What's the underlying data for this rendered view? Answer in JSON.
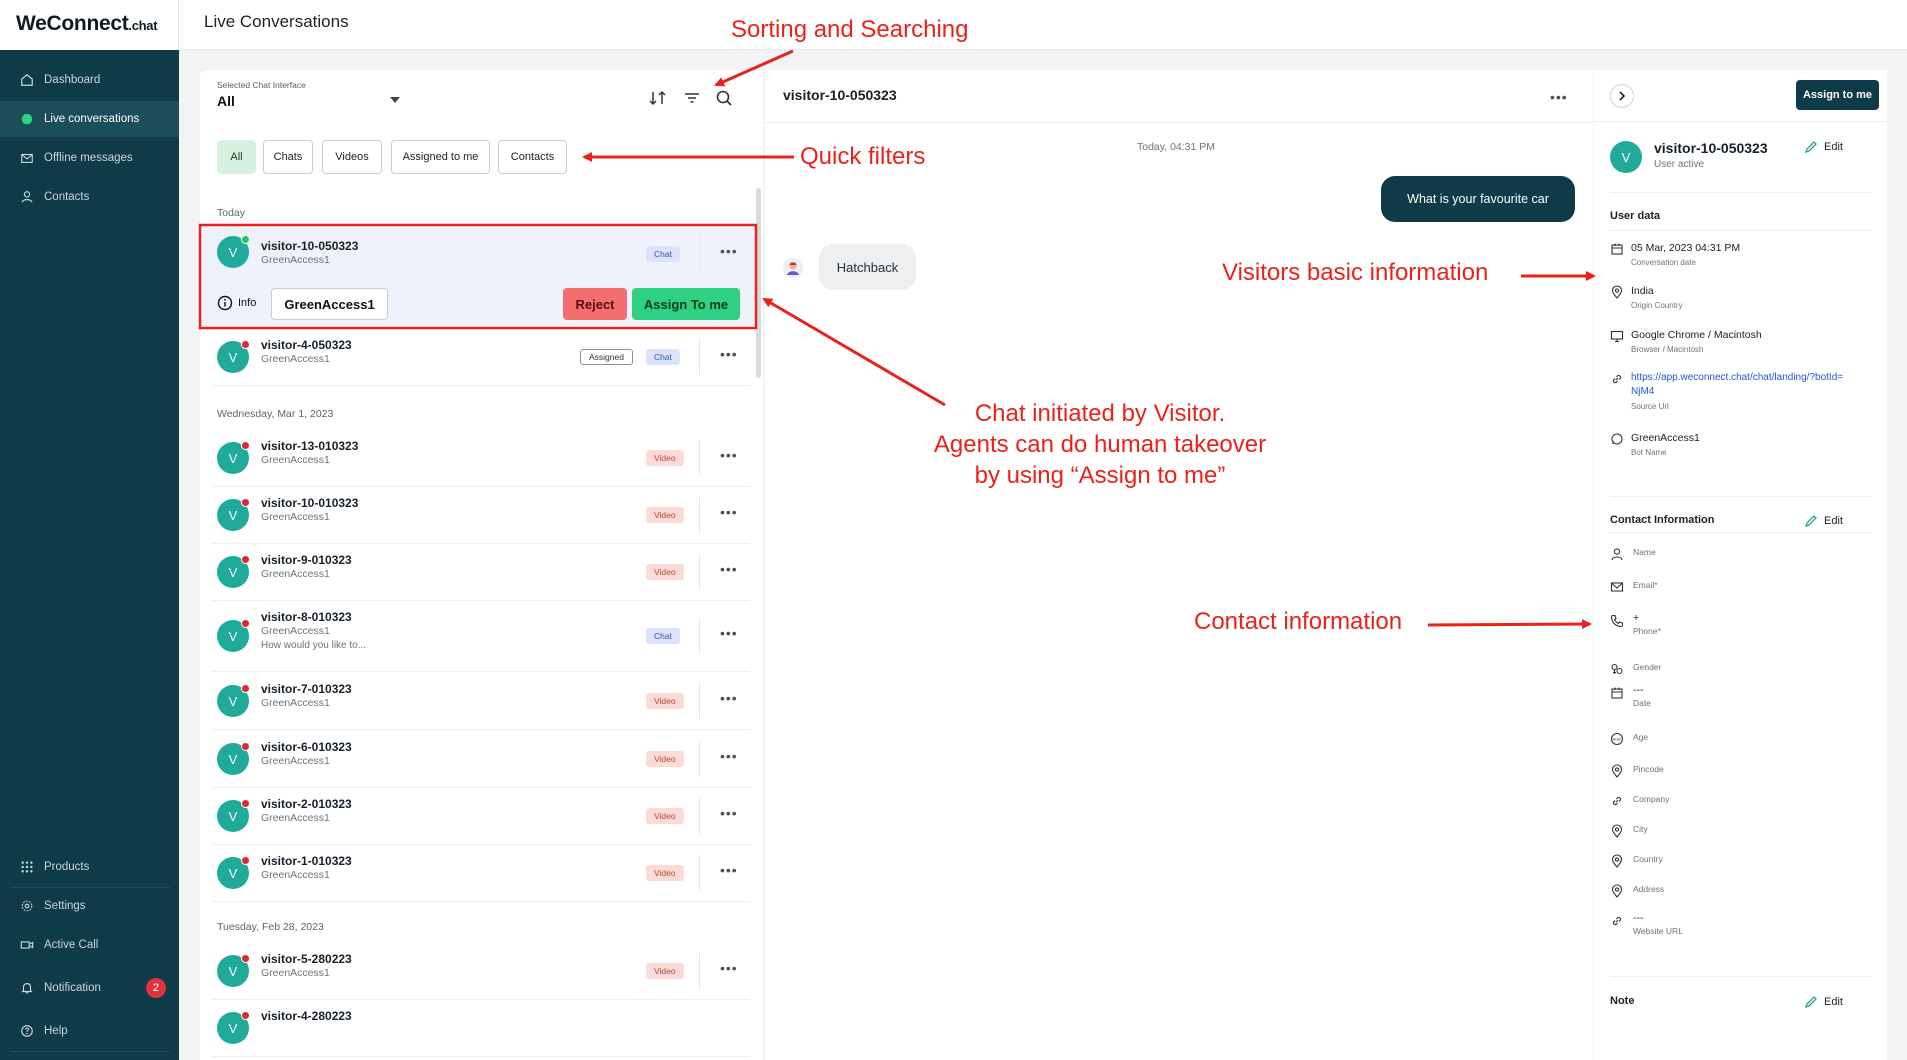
{
  "sidebar": {
    "logo": {
      "brand": "WeConnect",
      "suffix": ".chat"
    },
    "items": [
      {
        "label": "Dashboard",
        "icon": "home-icon"
      },
      {
        "label": "Live conversations",
        "icon": "chat-bubble-icon"
      },
      {
        "label": "Offline messages",
        "icon": "mail-icon"
      },
      {
        "label": "Contacts",
        "icon": "user-icon"
      }
    ],
    "bottom_items": [
      {
        "label": "Products",
        "icon": "grid-icon"
      },
      {
        "label": "Settings",
        "icon": "gear-icon"
      },
      {
        "label": "Active Call",
        "icon": "video-icon"
      },
      {
        "label": "Notification",
        "icon": "bell-icon",
        "badge": "2"
      },
      {
        "label": "Help",
        "icon": "help-icon"
      }
    ]
  },
  "header": {
    "title": "Live Conversations"
  },
  "list": {
    "interface_label": "Selected Chat Interface",
    "interface_value": "All",
    "quick_filters": [
      "All",
      "Chats",
      "Videos",
      "Assigned to me",
      "Contacts"
    ],
    "groups": {
      "today": "Today",
      "wed": "Wednesday, Mar 1, 2023",
      "tue": "Tuesday, Feb 28, 2023"
    },
    "selected": {
      "name": "visitor-10-050323",
      "bot": "GreenAccess1",
      "tag": "Chat",
      "info_label": "Info",
      "bot_button": "GreenAccess1",
      "reject": "Reject",
      "assign": "Assign To me"
    },
    "rows": [
      {
        "name": "visitor-4-050323",
        "bot": "GreenAccess1",
        "tag": "Chat",
        "assigned": "Assigned"
      },
      {
        "name": "visitor-13-010323",
        "bot": "GreenAccess1",
        "tag": "Video"
      },
      {
        "name": "visitor-10-010323",
        "bot": "GreenAccess1",
        "tag": "Video"
      },
      {
        "name": "visitor-9-010323",
        "bot": "GreenAccess1",
        "tag": "Video"
      },
      {
        "name": "visitor-8-010323",
        "bot": "GreenAccess1",
        "tag": "Chat",
        "msg": "How would you like to..."
      },
      {
        "name": "visitor-7-010323",
        "bot": "GreenAccess1",
        "tag": "Video"
      },
      {
        "name": "visitor-6-010323",
        "bot": "GreenAccess1",
        "tag": "Video"
      },
      {
        "name": "visitor-2-010323",
        "bot": "GreenAccess1",
        "tag": "Video"
      },
      {
        "name": "visitor-1-010323",
        "bot": "GreenAccess1",
        "tag": "Video"
      },
      {
        "name": "visitor-5-280223",
        "bot": "GreenAccess1",
        "tag": "Video"
      },
      {
        "name": "visitor-4-280223",
        "bot": "",
        "tag": ""
      }
    ],
    "avatar_letter": "V"
  },
  "chat": {
    "title": "visitor-10-050323",
    "timestamp": "Today, 04:31 PM",
    "outgoing": "What is your favourite car",
    "incoming": "Hatchback"
  },
  "info": {
    "assign_button": "Assign to me",
    "name": "visitor-10-050323",
    "status": "User active",
    "edit": "Edit",
    "user_data_title": "User data",
    "user_data": [
      {
        "value": "05 Mar, 2023 04:31 PM",
        "label": "Conversation date",
        "icon": "calendar-icon"
      },
      {
        "value": "India",
        "label": "Origin Country",
        "icon": "location-pin-icon"
      },
      {
        "value": "Google Chrome / Macintosh",
        "label": "Browser / Macintosh",
        "icon": "monitor-icon"
      },
      {
        "value": "https://app.weconnect.chat/chat/landing/?botId=",
        "value2": "NjM4",
        "label": "Source Url",
        "icon": "link-icon"
      },
      {
        "value": "GreenAccess1",
        "label": "Bot Name",
        "icon": "chat-icon"
      }
    ],
    "contact_title": "Contact Information",
    "contact_fields": [
      {
        "label": "Name",
        "icon": "user-icon"
      },
      {
        "label": "Email*",
        "icon": "mail-icon"
      },
      {
        "value": "+",
        "label": "Phone*",
        "icon": "phone-icon"
      },
      {
        "label": "Gender",
        "icon": "gender-icon"
      },
      {
        "value": "---",
        "label": "Date",
        "icon": "calendar-icon"
      },
      {
        "label": "Age",
        "icon": "age-icon"
      },
      {
        "label": "Pincode",
        "icon": "location-pin-icon"
      },
      {
        "label": "Company",
        "icon": "link-icon"
      },
      {
        "label": "City",
        "icon": "location-pin-icon"
      },
      {
        "label": "Country",
        "icon": "location-pin-icon"
      },
      {
        "label": "Address",
        "icon": "location-pin-icon"
      },
      {
        "value": "---",
        "label": "Website URL",
        "icon": "link-icon"
      }
    ],
    "note_title": "Note"
  },
  "annotations": {
    "sorting": "Sorting and Searching",
    "quick_filters": "Quick filters",
    "visitor_info": "Visitors basic information",
    "chat_initiated": [
      "Chat initiated by Visitor.",
      "Agents can do human takeover",
      "by using “Assign to me”"
    ],
    "contact_info": "Contact information"
  },
  "colors": {
    "sidebar": "#0e3b47",
    "accent_green": "#2ed082",
    "reject_red": "#f36f6f",
    "annotation_red": "#e8231b"
  }
}
